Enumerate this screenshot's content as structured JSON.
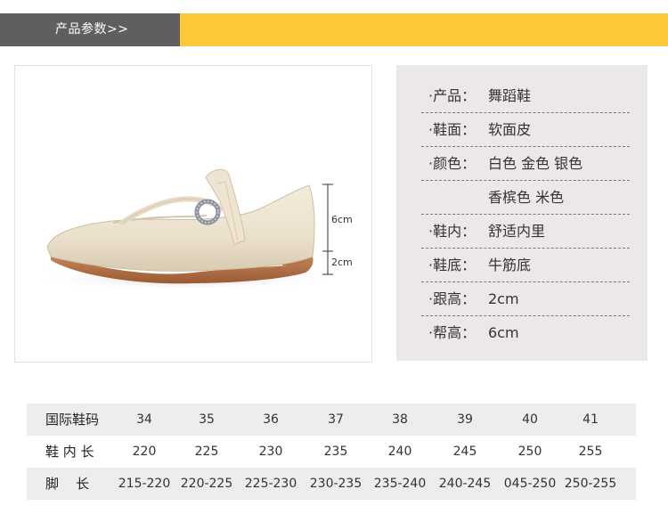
{
  "header": {
    "title": "产品参数>>"
  },
  "dimensions": {
    "upper_height": "6cm",
    "heel_height": "2cm"
  },
  "specs": [
    {
      "label": "·产品：",
      "value": "舞蹈鞋"
    },
    {
      "label": "·鞋面：",
      "value": "软面皮"
    },
    {
      "label": "·颜色：",
      "value": "白色  金色  银色"
    },
    {
      "label": "",
      "value": "香槟色  米色"
    },
    {
      "label": "·鞋内：",
      "value": "舒适内里"
    },
    {
      "label": "·鞋底：",
      "value": "牛筋底"
    },
    {
      "label": "·跟高：",
      "value": "2cm"
    },
    {
      "label": "·帮高：",
      "value": "6cm"
    }
  ],
  "size_table": {
    "rows": [
      {
        "header": "国际鞋码",
        "cells": [
          "34",
          "35",
          "36",
          "37",
          "38",
          "39",
          "40",
          "41"
        ]
      },
      {
        "header": "鞋 内 长",
        "cells": [
          "220",
          "225",
          "230",
          "235",
          "240",
          "245",
          "250",
          "255"
        ]
      },
      {
        "header": "脚    长",
        "cells": [
          "215-220",
          "220-225",
          "225-230",
          "230-235",
          "235-240",
          "240-245",
          "045-250",
          "250-255"
        ]
      }
    ]
  },
  "colors": {
    "accent_yellow": "#fdc83a",
    "tab_gray": "#5f5f5f",
    "spec_bg": "#ede8e8",
    "table_shade": "#ededed"
  }
}
